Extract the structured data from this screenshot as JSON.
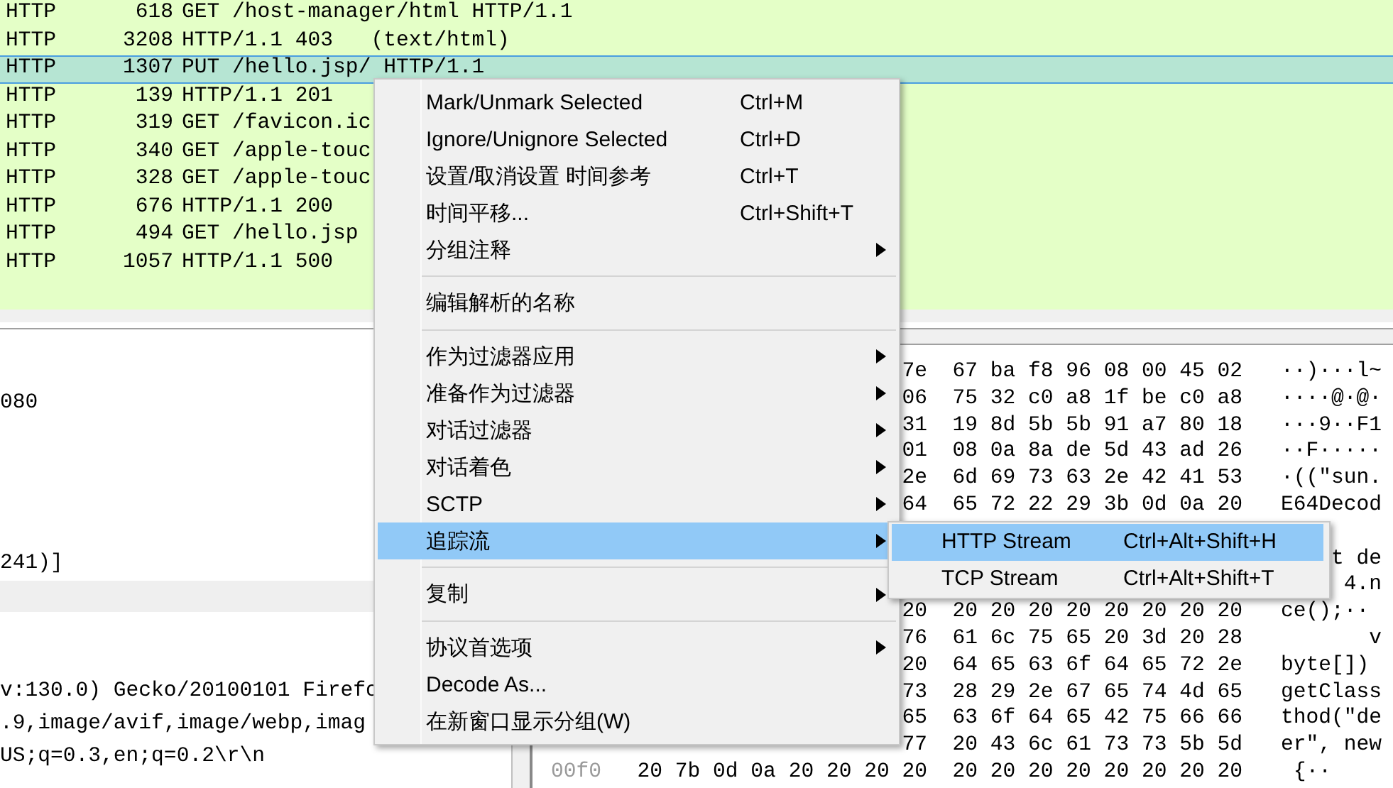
{
  "packets": [
    {
      "protocol": "HTTP",
      "length": "618",
      "info": "GET /host-manager/html HTTP/1.1",
      "selected": false
    },
    {
      "protocol": "HTTP",
      "length": "3208",
      "info": "HTTP/1.1 403   (text/html)",
      "selected": false
    },
    {
      "protocol": "HTTP",
      "length": "1307",
      "info": "PUT /hello.jsp/ HTTP/1.1",
      "selected": true
    },
    {
      "protocol": "HTTP",
      "length": "139",
      "info": "HTTP/1.1 201",
      "selected": false
    },
    {
      "protocol": "HTTP",
      "length": "319",
      "info": "GET /favicon.ic",
      "selected": false
    },
    {
      "protocol": "HTTP",
      "length": "340",
      "info": "GET /apple-touc",
      "selected": false
    },
    {
      "protocol": "HTTP",
      "length": "328",
      "info": "GET /apple-touc",
      "selected": false
    },
    {
      "protocol": "HTTP",
      "length": "676",
      "info": "HTTP/1.1 200",
      "selected": false
    },
    {
      "protocol": "HTTP",
      "length": "494",
      "info": "GET /hello.jsp",
      "selected": false
    },
    {
      "protocol": "HTTP",
      "length": "1057",
      "info": "HTTP/1.1 500",
      "selected": false
    }
  ],
  "details": {
    "rows": [
      {
        "text": "080",
        "selected": false
      },
      {
        "selected": false
      },
      {
        "selected": false
      },
      {
        "selected": false
      },
      {
        "selected": false
      },
      {
        "text": "241)]",
        "selected": false
      },
      {
        "selected": true
      },
      {
        "selected": false
      },
      {
        "selected": false
      },
      {
        "text": "v:130.0) Gecko/20100101 Firefo",
        "selected": false
      },
      {
        "text": ".9,image/avif,image/webp,imag",
        "selected": false
      },
      {
        "text": "US;q=0.3,en;q=0.2\\r\\n",
        "selected": false
      }
    ]
  },
  "bytes": {
    "rows": [
      {
        "hex": "7e  67 ba f8 96 08 00 45 02",
        "ascii": "··)···l~"
      },
      {
        "hex": "06  75 32 c0 a8 1f be c0 a8",
        "ascii": "····@·@·"
      },
      {
        "hex": "31  19 8d 5b 5b 91 a7 80 18",
        "ascii": "···9··F1"
      },
      {
        "hex": "01  08 0a 8a de 5d 43 ad 26",
        "ascii": "··F·····"
      },
      {
        "hex": "2e  6d 69 73 63 2e 42 41 53",
        "ascii": "·((\"sun."
      },
      {
        "hex": "64  65 72 22 29 3b 0d 0a 20",
        "ascii": "E64Decod"
      },
      {},
      {
        "ascii": "t de"
      },
      {
        "ascii": "4.n"
      },
      {
        "hex": "20  20 20 20 20 20 20 20 20",
        "ascii": "ce();·· "
      },
      {
        "hex": "76  61 6c 75 65 20 3d 20 28",
        "ascii": "       v"
      },
      {
        "hex": "20  64 65 63 6f 64 65 72 2e",
        "ascii": "byte[]) "
      },
      {
        "hex": "73  28 29 2e 67 65 74 4d 65",
        "ascii": "getClass"
      },
      {
        "hex": "65  63 6f 64 65 42 75 66 66",
        "ascii": "thod(\"de"
      },
      {
        "hex": "77  20 43 6c 61 73 73 5b 5d",
        "ascii": "er\", new"
      },
      {
        "offset": "00f0",
        "hex": "20 7b 0d 0a 20 20 20 20  20 20 20 20 20 20 20 20",
        "ascii": " {··    "
      }
    ]
  },
  "context_menu": {
    "items": [
      {
        "kind": "item",
        "label": "Mark/Unmark Selected",
        "shortcut": "Ctrl+M",
        "has_submenu": false,
        "selected": false
      },
      {
        "kind": "item",
        "label": "Ignore/Unignore Selected",
        "shortcut": "Ctrl+D",
        "has_submenu": false,
        "selected": false
      },
      {
        "kind": "item",
        "label": "设置/取消设置 时间参考",
        "shortcut": "Ctrl+T",
        "has_submenu": false,
        "selected": false
      },
      {
        "kind": "item",
        "label": "时间平移...",
        "shortcut": "Ctrl+Shift+T",
        "has_submenu": false,
        "selected": false
      },
      {
        "kind": "item",
        "label": "分组注释",
        "has_submenu": true,
        "selected": false
      },
      {
        "kind": "separator"
      },
      {
        "kind": "item",
        "label": "编辑解析的名称",
        "has_submenu": false,
        "selected": false
      },
      {
        "kind": "separator"
      },
      {
        "kind": "item",
        "label": "作为过滤器应用",
        "has_submenu": true,
        "selected": false
      },
      {
        "kind": "item",
        "label": "准备作为过滤器",
        "has_submenu": true,
        "selected": false
      },
      {
        "kind": "item",
        "label": "对话过滤器",
        "has_submenu": true,
        "selected": false
      },
      {
        "kind": "item",
        "label": "对话着色",
        "has_submenu": true,
        "selected": false
      },
      {
        "kind": "item",
        "label": "SCTP",
        "has_submenu": true,
        "selected": false
      },
      {
        "kind": "item",
        "label": "追踪流",
        "has_submenu": true,
        "selected": true
      },
      {
        "kind": "separator"
      },
      {
        "kind": "item",
        "label": "复制",
        "has_submenu": true,
        "selected": false
      },
      {
        "kind": "separator"
      },
      {
        "kind": "item",
        "label": "协议首选项",
        "has_submenu": true,
        "selected": false
      },
      {
        "kind": "item",
        "label": "Decode As...",
        "has_submenu": false,
        "selected": false
      },
      {
        "kind": "item",
        "label": "在新窗口显示分组(W)",
        "has_submenu": false,
        "selected": false
      }
    ]
  },
  "submenu": {
    "items": [
      {
        "label": "HTTP Stream",
        "shortcut": "Ctrl+Alt+Shift+H",
        "selected": true
      },
      {
        "label": "TCP Stream",
        "shortcut": "Ctrl+Alt+Shift+T",
        "selected": false
      }
    ]
  }
}
